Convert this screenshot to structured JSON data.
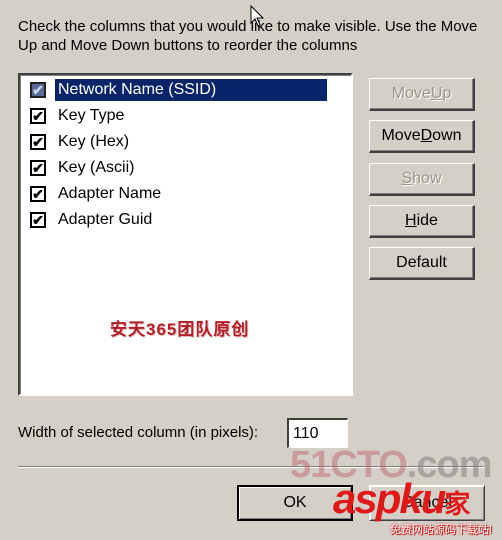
{
  "dialog": {
    "instructions": "Check the columns that you would like to make visible. Use the Move Up and Move Down buttons to reorder the columns"
  },
  "columns": [
    {
      "label": "Network Name (SSID)",
      "checked": true,
      "selected": true
    },
    {
      "label": "Key Type",
      "checked": true,
      "selected": false
    },
    {
      "label": "Key (Hex)",
      "checked": true,
      "selected": false
    },
    {
      "label": "Key (Ascii)",
      "checked": true,
      "selected": false
    },
    {
      "label": "Adapter Name",
      "checked": true,
      "selected": false
    },
    {
      "label": "Adapter Guid",
      "checked": true,
      "selected": false
    }
  ],
  "buttons": {
    "move_up": {
      "pre": "Move ",
      "accel": "U",
      "post": "p",
      "enabled": false
    },
    "move_down": {
      "pre": "Move ",
      "accel": "D",
      "post": "own",
      "enabled": true
    },
    "show": {
      "pre": "",
      "accel": "S",
      "post": "how",
      "enabled": false
    },
    "hide": {
      "pre": "",
      "accel": "H",
      "post": "ide",
      "enabled": true
    },
    "default": {
      "label": "Default",
      "enabled": true
    },
    "ok": "OK",
    "cancel": "Cancel"
  },
  "width_field": {
    "label": "Width of selected column (in pixels):",
    "value": "110"
  },
  "watermarks": {
    "center": "安天365团队原创",
    "site1_main": "51CTO",
    "site1_tld": ".com",
    "site2": "aspku",
    "site2_suffix": "家",
    "site2_sub": "免费网站源码下载站!"
  },
  "colors": {
    "selection": "#0a246a",
    "dialog_bg": "#d4d0c8"
  }
}
